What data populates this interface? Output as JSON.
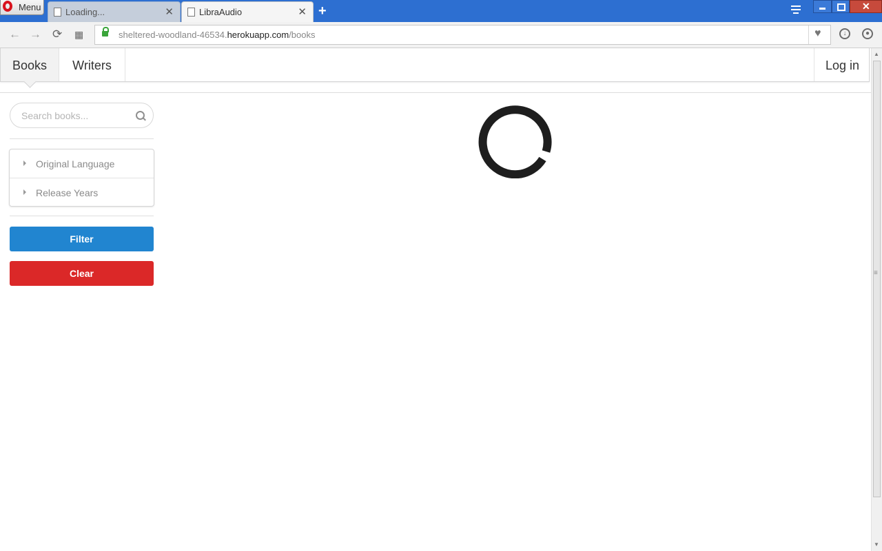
{
  "browser": {
    "menu_label": "Menu",
    "tabs": [
      {
        "title": "Loading..."
      },
      {
        "title": "LibraAudio"
      }
    ],
    "new_tab_symbol": "+",
    "address": {
      "prefix": "sheltered-woodland-46534.",
      "domain": "herokuapp.com",
      "path": "/books"
    }
  },
  "navbar": {
    "books": "Books",
    "writers": "Writers",
    "login": "Log in"
  },
  "sidebar": {
    "search_placeholder": "Search books...",
    "filters": [
      {
        "label": "Original Language"
      },
      {
        "label": "Release Years"
      }
    ],
    "filter_button": "Filter",
    "clear_button": "Clear"
  },
  "colors": {
    "filter": "#2185d0",
    "clear": "#db2828",
    "titlebar": "#2d6fd1"
  }
}
